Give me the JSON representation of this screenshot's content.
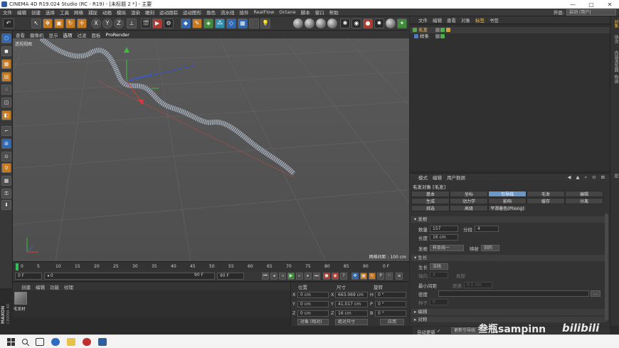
{
  "window": {
    "title": "CINEMA 4D R19.024 Studio (RC - R19) - [未标题 2 *] - 主要",
    "controls": [
      "—",
      "▢",
      "✕"
    ]
  },
  "menubar": {
    "items": [
      "文件",
      "编辑",
      "创建",
      "选择",
      "工具",
      "网格",
      "捕捉",
      "动画",
      "模拟",
      "渲染",
      "雕刻",
      "运动跟踪",
      "运动图形",
      "角色",
      "流水线",
      "插件",
      "RealFlow",
      "Octane",
      "脚本",
      "窗口",
      "帮助"
    ],
    "layout_label": "界面:",
    "layout_value": "启动 (用户)"
  },
  "toolbar": {
    "xyz": [
      "X",
      "Y",
      "Z"
    ]
  },
  "viewport": {
    "menu": [
      "查看",
      "摄像机",
      "显示",
      "选项",
      "过滤",
      "面板",
      "ProRender"
    ],
    "label": "透视视图",
    "grid_readout": "网格间距 : 100 cm"
  },
  "timeline": {
    "ticks": [
      "0",
      "5",
      "10",
      "15",
      "20",
      "25",
      "30",
      "35",
      "40",
      "45",
      "50",
      "55",
      "60",
      "65",
      "70",
      "75",
      "80",
      "85",
      "90"
    ],
    "end_label": "0 F"
  },
  "transport": {
    "start": "0 F",
    "current": "◂ 0",
    "end": "90 F",
    "max": "90 F"
  },
  "materials": {
    "menu": [
      "创建",
      "编辑",
      "功能",
      "纹理"
    ],
    "item": "毛发材"
  },
  "brand": {
    "line1": "MAXON",
    "line2": "CINEMA 4D"
  },
  "coords": {
    "headers": [
      "位置",
      "尺寸",
      "旋转"
    ],
    "rows": [
      {
        "axis": "X",
        "pos": "0 cm",
        "size": "663.069 cm",
        "rot_axis": "H",
        "rot": "0 °"
      },
      {
        "axis": "Y",
        "pos": "0 cm",
        "size": "41.017 cm",
        "rot_axis": "P",
        "rot": "0 °"
      },
      {
        "axis": "Z",
        "pos": "0 cm",
        "size": "16 cm",
        "rot_axis": "B",
        "rot": "0 °"
      }
    ],
    "mode_object": "对象 (相对)",
    "mode_size": "绝对尺寸",
    "apply": "应用"
  },
  "objects": {
    "menu": [
      "文件",
      "编辑",
      "查看",
      "对象",
      "标签",
      "书签"
    ],
    "active_menu_index": 4,
    "rows": [
      {
        "name": "毛发",
        "selected": true
      },
      {
        "name": "样条",
        "selected": false
      }
    ]
  },
  "right_strip": [
    "对象",
    "场次",
    "内容浏览器",
    "构造",
    "层"
  ],
  "attributes": {
    "menu": [
      "模式",
      "编辑",
      "用户数据"
    ],
    "object_title": "毛发对象 [毛发]",
    "tabs_row1": [
      "基本",
      "坐标",
      "引导线",
      "毛发",
      "编辑"
    ],
    "tabs_row2": [
      "生成",
      "动力学",
      "影响",
      "缓存",
      "分离"
    ],
    "tabs_row3": [
      "挑选",
      "高级",
      "平滑着色(Phong)"
    ],
    "active_tab": "引导线",
    "section_guides": "发根",
    "count_label": "数量",
    "count_value": "157",
    "segments_label": "分段",
    "segments_value": "4",
    "length_label": "长度",
    "length_value": "16 cm",
    "root_label": "发根",
    "root_value": "样条线一",
    "mapping_label": "映射",
    "mapping_value": "旧的",
    "section_grow": "生长",
    "grow_label": "生长",
    "grow_value": "法线",
    "axis_label": "轴向",
    "axis_value": "X",
    "local_label": "局部",
    "min_dist_label": "最小间距",
    "dist_label": "距离",
    "dist_value": "0.1 cm",
    "density_label": "密度",
    "seed_label": "种子",
    "seed_value": "0",
    "section_edit": "编辑",
    "section_sym": "对称",
    "auto_update": "自动更新",
    "update_btn": "更新引导线"
  },
  "watermark": {
    "text": "叁瓶sampinn",
    "logo": "bilibili"
  }
}
